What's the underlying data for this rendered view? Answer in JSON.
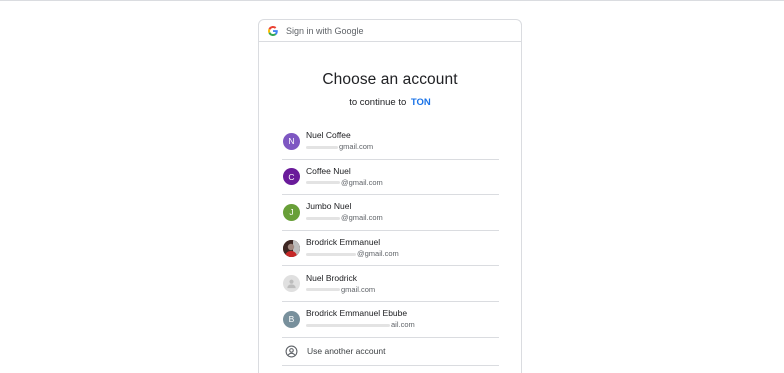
{
  "header": {
    "text": "Sign in with Google",
    "logo_icon": "google-g-icon"
  },
  "title": "Choose an account",
  "subtitle": {
    "prefix": "to continue to",
    "app_name": "TON"
  },
  "accounts": [
    {
      "name": "Nuel Coffee",
      "email": "gmail.com",
      "avatar_letter": "N",
      "avatar_color": "#7e57c2"
    },
    {
      "name": "Coffee Nuel",
      "email": "@gmail.com",
      "avatar_letter": "C",
      "avatar_color": "#6a1b9a"
    },
    {
      "name": "Jumbo Nuel",
      "email": "@gmail.com",
      "avatar_letter": "J",
      "avatar_color": "#689f38"
    },
    {
      "name": "Brodrick Emmanuel",
      "email": "@gmail.com",
      "avatar_letter": "",
      "avatar_color": "#5d4037",
      "avatar_icon": "profile-photo"
    },
    {
      "name": "Nuel Brodrick",
      "email": "gmail.com",
      "avatar_letter": "",
      "avatar_color": "#e0e0e0",
      "avatar_icon": "default-person-icon"
    },
    {
      "name": "Brodrick Emmanuel Ebube",
      "email": "ail.com",
      "avatar_letter": "B",
      "avatar_color": "#78909c"
    }
  ],
  "use_another": {
    "label": "Use another account",
    "icon": "account-circle-icon"
  },
  "colors": {
    "link": "#1a73e8",
    "divider": "#dadce0"
  }
}
